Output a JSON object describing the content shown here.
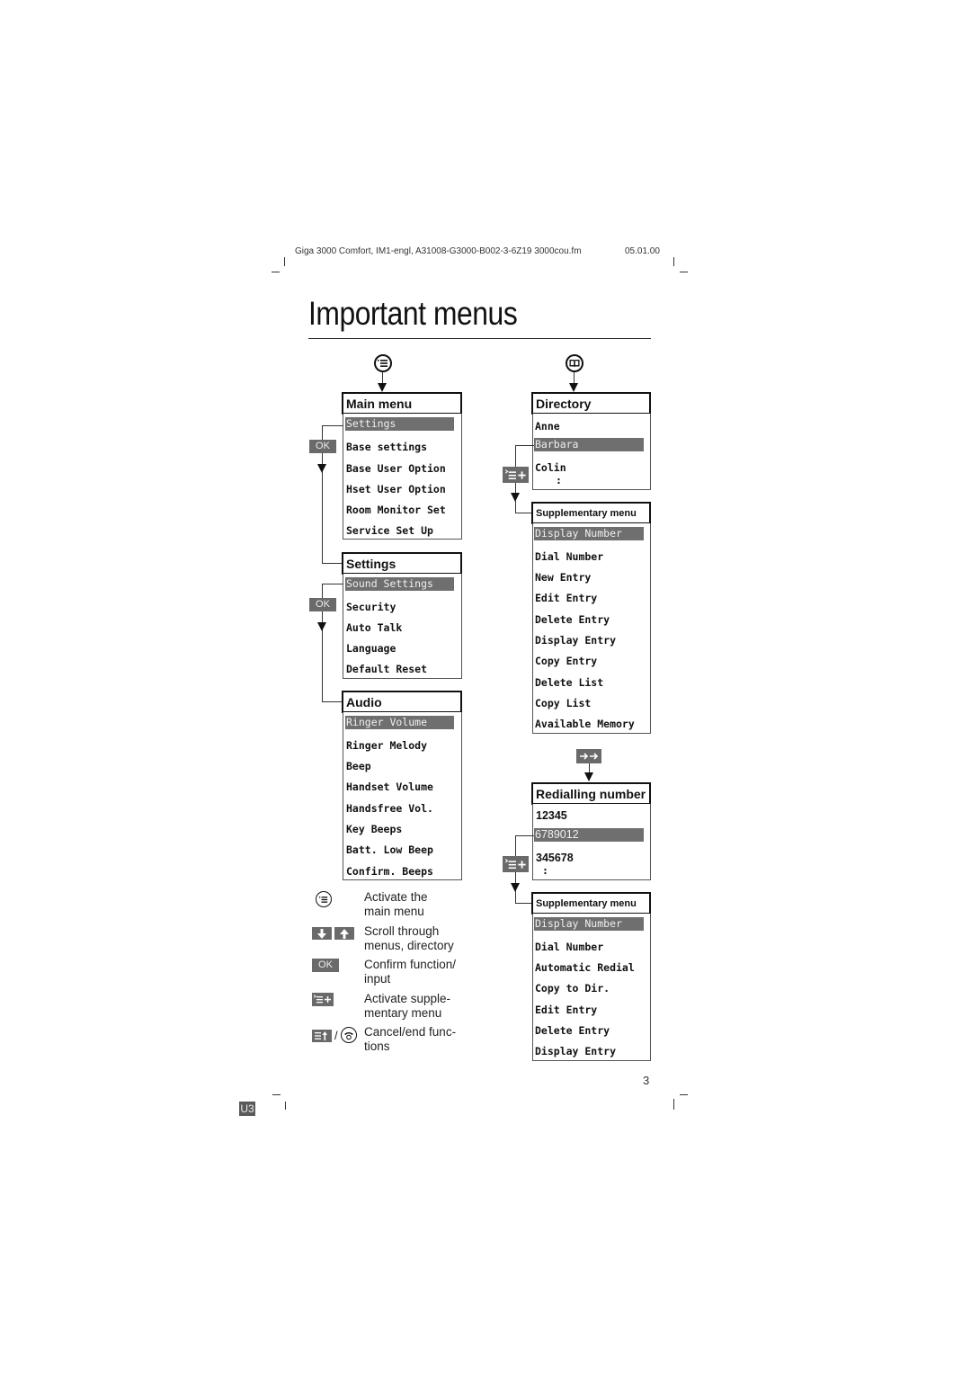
{
  "header": {
    "meta": "Giga 3000 Comfort, IM1-engl, A31008-G3000-B002-3-6Z19  3000cou.fm",
    "date": "05.01.00"
  },
  "page": {
    "title": "Important menus",
    "number": "3",
    "tag": "U3"
  },
  "keys": {
    "ok": "OK",
    "menu_icon": "menu-key-icon",
    "directory_icon": "directory-key-icon",
    "redial_icon": "redial-key-icon",
    "supplementary_icon": "supplementary-menu-key-icon"
  },
  "main_menu": {
    "title": "Main menu",
    "items": [
      "Settings",
      "Base settings",
      "Base User Option",
      "Hset User Option",
      "Room Monitor Set",
      "Service Set Up"
    ],
    "selected_index": 0
  },
  "settings_menu": {
    "title": "Settings",
    "items": [
      "Sound Settings",
      "Security",
      "Auto Talk",
      "Language",
      "Default Reset"
    ],
    "selected_index": 0
  },
  "audio_menu": {
    "title": "Audio",
    "items": [
      "Ringer Volume",
      "Ringer Melody",
      "Beep",
      "Handset Volume",
      "Handsfree Vol.",
      "Key Beeps",
      "Batt. Low Beep",
      "Confirm. Beeps"
    ],
    "selected_index": 0
  },
  "directory": {
    "title": "Directory",
    "items": [
      "Anne",
      "Barbara",
      "Colin",
      ":"
    ],
    "selected_index": 1
  },
  "directory_supplementary": {
    "title": "Supplementary menu",
    "items": [
      "Display Number",
      "Dial Number",
      "New Entry",
      "Edit Entry",
      "Delete Entry",
      "Display Entry",
      "Copy Entry",
      "Delete List",
      "Copy List",
      "Available Memory"
    ],
    "selected_index": 0
  },
  "redial": {
    "title": "Redialling number",
    "items": [
      "12345",
      "6789012",
      "345678",
      ":"
    ],
    "selected_index": 1
  },
  "redial_supplementary": {
    "title": "Supplementary menu",
    "items": [
      "Display Number",
      "Dial Number",
      "Automatic Redial",
      "Copy to Dir.",
      "Edit Entry",
      "Delete Entry",
      "Display Entry"
    ],
    "selected_index": 0
  },
  "legend": [
    {
      "icon": "menu-key-icon",
      "text_line1": "Activate the",
      "text_line2": "main menu"
    },
    {
      "icon": "scroll-keys-icon",
      "text_line1": "Scroll through",
      "text_line2": "menus, directory"
    },
    {
      "icon": "ok-key-icon",
      "key_label": "OK",
      "text_line1": "Confirm function/",
      "text_line2": "input"
    },
    {
      "icon": "supplementary-menu-key-icon",
      "text_line1": "Activate supple-",
      "text_line2": "mentary menu"
    },
    {
      "icon": "cancel-end-key-icon",
      "separator": "/",
      "text_line1": "Cancel/end func-",
      "text_line2": "tions"
    }
  ]
}
